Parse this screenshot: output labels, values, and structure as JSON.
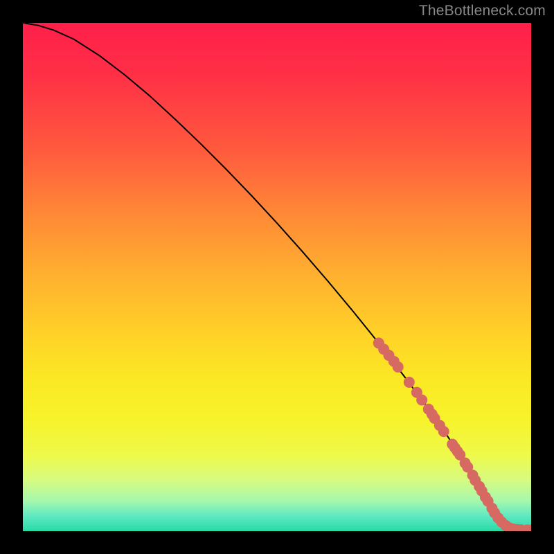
{
  "watermark": "TheBottleneck.com",
  "chart_data": {
    "type": "line",
    "title": "",
    "xlabel": "",
    "ylabel": "",
    "xlim": [
      0,
      100
    ],
    "ylim": [
      0,
      100
    ],
    "series": [
      {
        "name": "curve",
        "x": [
          0,
          3,
          6,
          10,
          15,
          20,
          25,
          30,
          35,
          40,
          45,
          50,
          55,
          60,
          65,
          70,
          75,
          80,
          83,
          86,
          88,
          90,
          92,
          94,
          96,
          98,
          100
        ],
        "y": [
          100,
          99.5,
          98.6,
          96.8,
          93.6,
          89.8,
          85.6,
          81.0,
          76.2,
          71.2,
          66.0,
          60.6,
          55.0,
          49.2,
          43.2,
          37.0,
          30.5,
          23.8,
          19.5,
          15.0,
          11.8,
          8.4,
          5.0,
          2.4,
          0.9,
          0.3,
          0.2
        ]
      }
    ],
    "markers": {
      "name": "highlight-points",
      "color": "#d66a63",
      "radius_px": 8,
      "points": [
        {
          "x": 70.0,
          "y": 37.0
        },
        {
          "x": 71.0,
          "y": 35.8
        },
        {
          "x": 72.0,
          "y": 34.6
        },
        {
          "x": 73.0,
          "y": 33.4
        },
        {
          "x": 73.8,
          "y": 32.3
        },
        {
          "x": 76.0,
          "y": 29.3
        },
        {
          "x": 77.5,
          "y": 27.3
        },
        {
          "x": 78.5,
          "y": 25.8
        },
        {
          "x": 79.8,
          "y": 24.0
        },
        {
          "x": 80.5,
          "y": 23.0
        },
        {
          "x": 81.0,
          "y": 22.2
        },
        {
          "x": 82.0,
          "y": 20.8
        },
        {
          "x": 82.8,
          "y": 19.6
        },
        {
          "x": 84.5,
          "y": 17.1
        },
        {
          "x": 85.0,
          "y": 16.4
        },
        {
          "x": 85.5,
          "y": 15.7
        },
        {
          "x": 86.0,
          "y": 15.0
        },
        {
          "x": 87.0,
          "y": 13.4
        },
        {
          "x": 87.5,
          "y": 12.6
        },
        {
          "x": 88.5,
          "y": 11.0
        },
        {
          "x": 89.0,
          "y": 10.0
        },
        {
          "x": 89.8,
          "y": 8.8
        },
        {
          "x": 90.3,
          "y": 7.9
        },
        {
          "x": 91.0,
          "y": 6.7
        },
        {
          "x": 91.5,
          "y": 5.9
        },
        {
          "x": 92.3,
          "y": 4.5
        },
        {
          "x": 92.8,
          "y": 3.6
        },
        {
          "x": 93.5,
          "y": 2.6
        },
        {
          "x": 94.2,
          "y": 1.8
        },
        {
          "x": 95.0,
          "y": 1.1
        },
        {
          "x": 95.8,
          "y": 0.6
        },
        {
          "x": 96.5,
          "y": 0.4
        },
        {
          "x": 97.3,
          "y": 0.3
        },
        {
          "x": 98.0,
          "y": 0.25
        },
        {
          "x": 99.2,
          "y": 0.22
        },
        {
          "x": 100.0,
          "y": 0.2
        }
      ]
    }
  }
}
